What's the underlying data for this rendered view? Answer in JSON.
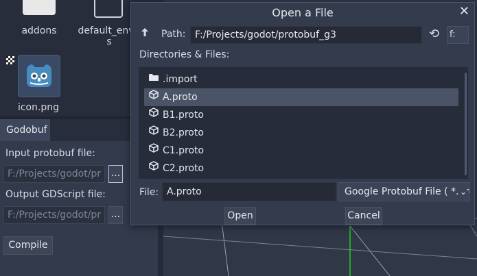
{
  "filesystem": {
    "items": [
      {
        "label": "addons",
        "icon": "folder-icon"
      },
      {
        "label": "default_env.t",
        "label2": "s",
        "icon": "file-icon"
      },
      {
        "label": "icon.png",
        "icon": "godot-icon"
      }
    ]
  },
  "godobuf": {
    "tab_label": "Godobuf",
    "input_label": "Input protobuf file:",
    "input_value": "F:/Projects/godot/pr",
    "browse_label": "...",
    "output_label": "Output GDScript file:",
    "output_value": "F:/Projects/godot/pr",
    "compile_label": "Compile"
  },
  "dialog": {
    "title": "Open a File",
    "close_glyph": "✕",
    "up_glyph": "🡑",
    "path_label": "Path:",
    "path_value": "F:/Projects/godot/protobuf_g3",
    "refresh_glyph": "⟲",
    "drive_value": "f:",
    "dirs_label": "Directories & Files:",
    "entries": [
      {
        "name": ".import",
        "icon": "folder-icon",
        "selected": false
      },
      {
        "name": "A.proto",
        "icon": "file-icon",
        "selected": true
      },
      {
        "name": "B1.proto",
        "icon": "file-icon",
        "selected": false
      },
      {
        "name": "B2.proto",
        "icon": "file-icon",
        "selected": false
      },
      {
        "name": "C1.proto",
        "icon": "file-icon",
        "selected": false
      },
      {
        "name": "C2.proto",
        "icon": "file-icon",
        "selected": false
      }
    ],
    "file_label": "File:",
    "file_value": "A.proto",
    "filter_value": "Google Protobuf File ( *.proto )",
    "filter_arrow": "⌄",
    "open_label": "Open",
    "cancel_label": "Cancel"
  },
  "colors": {
    "dialog_bg": "#333b4d",
    "selection": "#4b5467",
    "grid_green": "#22cc22",
    "grid_line": "#8a8f9a"
  }
}
